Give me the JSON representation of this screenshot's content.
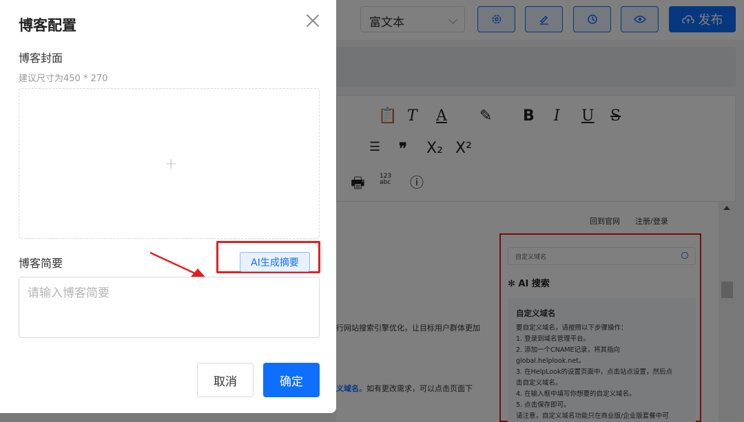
{
  "header": {
    "editor_type": "富文本",
    "publish_label": "发布",
    "icons": [
      "gear-icon",
      "pencil-icon",
      "history-icon",
      "eye-icon",
      "cloud-upload-icon"
    ]
  },
  "editor": {
    "site_links": [
      "回到官网",
      "注册/登录"
    ],
    "preview": {
      "search_placeholder": "自定义域名",
      "ai_title": "AI 搜索",
      "card_title": "自定义域名",
      "card_lines": [
        "要自定义域名，请按照以下步骤操作：",
        "1. 登录到域名管理平台。",
        "2. 添加一个CNAME记录，将其指向",
        "global.helplook.net。",
        "3. 在HelpLook的设置页面中，点击站点设置，然后点",
        "击自定义域名。",
        "4. 在输入框中填写你想要的自定义域名。",
        "5. 点击保存即可。",
        "请注意，自定义域名功能只在商业版/企业版套餐中可"
      ]
    },
    "text1": "行网站搜索引擎优化，让目标用户群体更加",
    "text2_bold": "义域名",
    "text2_rest": "。如有更改需求，可以点击页面下"
  },
  "modal": {
    "title": "博客配置",
    "cover_label": "博客封面",
    "cover_hint": "建议尺寸为450 * 270",
    "summary_label": "博客简要",
    "ai_button": "AI生成摘要",
    "summary_placeholder": "请输入博客简要",
    "cancel": "取消",
    "confirm": "确定"
  },
  "colors": {
    "primary": "#0e6ffc",
    "highlight": "#e0201f"
  }
}
